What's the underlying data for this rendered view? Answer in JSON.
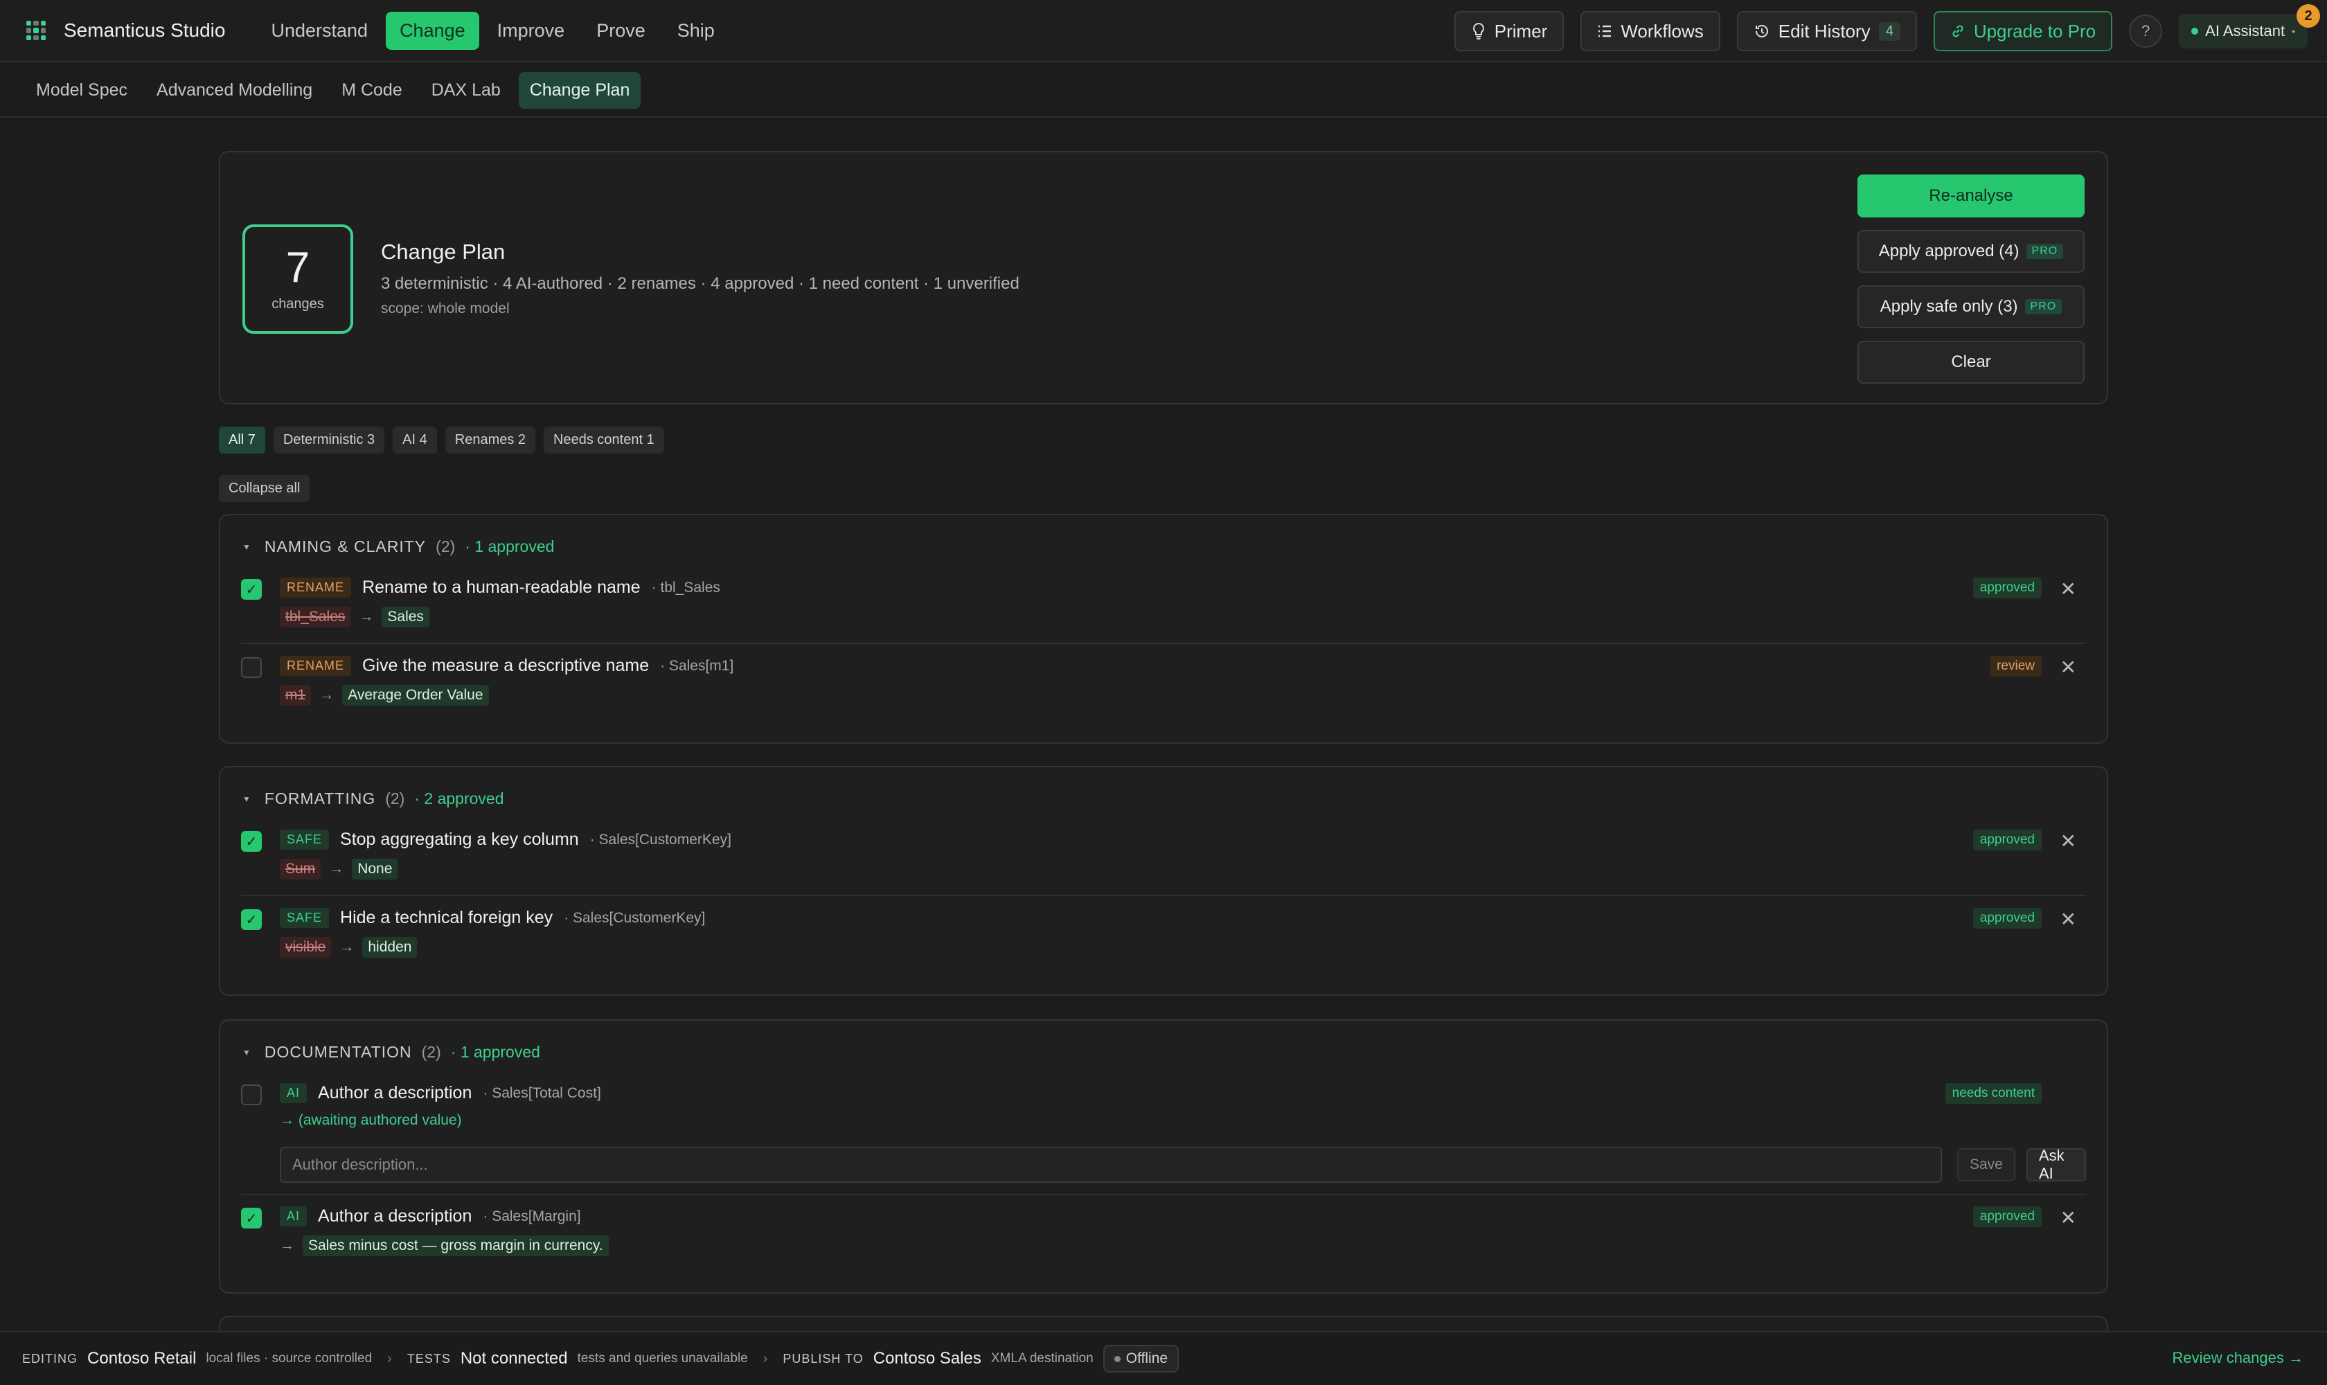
{
  "app": {
    "brand": "Semanticus Studio"
  },
  "nav": {
    "items": [
      "Understand",
      "Change",
      "Improve",
      "Prove",
      "Ship"
    ],
    "active": "Change"
  },
  "top": {
    "primer": "Primer",
    "workflows": "Workflows",
    "edit_history": "Edit History",
    "edit_history_count": "4",
    "upgrade": "Upgrade to Pro",
    "help": "?",
    "ai_assistant": "AI Assistant",
    "ai_badge": "2"
  },
  "subnav": {
    "items": [
      "Model Spec",
      "Advanced Modelling",
      "M Code",
      "DAX Lab",
      "Change Plan"
    ],
    "active": "Change Plan"
  },
  "summary": {
    "count": "7",
    "count_label": "changes",
    "title": "Change Plan",
    "meta": "3 deterministic · 4 AI-authored · 2 renames · 4 approved · 1 need content · 1 unverified",
    "scope": "scope: whole model",
    "reanalyse": "Re-analyse",
    "apply_approved": "Apply approved (4)",
    "apply_safe": "Apply safe only (3)",
    "pro": "PRO",
    "clear": "Clear"
  },
  "filters": [
    "All 7",
    "Deterministic 3",
    "AI 4",
    "Renames 2",
    "Needs content 1"
  ],
  "collapse_all": "Collapse all",
  "groups": [
    {
      "title": "NAMING & CLARITY",
      "count": "(2)",
      "approved": "· 1 approved",
      "rows": [
        {
          "checked": true,
          "tag": "RENAME",
          "title": "Rename to a human-readable name",
          "target": "· tbl_Sales",
          "old": "tbl_Sales",
          "new": "Sales",
          "status": "approved"
        },
        {
          "checked": false,
          "tag": "RENAME",
          "title": "Give the measure a descriptive name",
          "target": "· Sales[m1]",
          "old": "m1",
          "new": "Average Order Value",
          "status": "review"
        }
      ]
    },
    {
      "title": "FORMATTING",
      "count": "(2)",
      "approved": "· 2 approved",
      "rows": [
        {
          "checked": true,
          "tag": "SAFE",
          "title": "Stop aggregating a key column",
          "target": "· Sales[CustomerKey]",
          "old": "Sum",
          "new": "None",
          "status": "approved"
        },
        {
          "checked": true,
          "tag": "SAFE",
          "title": "Hide a technical foreign key",
          "target": "· Sales[CustomerKey]",
          "old": "visible",
          "new": "hidden",
          "status": "approved"
        }
      ]
    },
    {
      "title": "DOCUMENTATION",
      "count": "(2)",
      "approved": "· 1 approved",
      "rows": [
        {
          "checked": false,
          "tag": "AI",
          "title": "Author a description",
          "target": "· Sales[Total Cost]",
          "awaiting": "→ (awaiting authored value)",
          "status": "needs content",
          "input_placeholder": "Author description...",
          "save": "Save",
          "ask_ai": "Ask AI"
        },
        {
          "checked": true,
          "tag": "AI",
          "title": "Author a description",
          "target": "· Sales[Margin]",
          "new": "Sales minus cost — gross margin in currency.",
          "status": "approved"
        }
      ]
    }
  ],
  "arrow": "→",
  "statusbar": {
    "editing_key": "EDITING",
    "editing_val": "Contoso Retail",
    "editing_note": "local files · source controlled",
    "tests_key": "TESTS",
    "tests_val": "Not connected",
    "tests_note": "tests and queries unavailable",
    "publish_key": "PUBLISH TO",
    "publish_val": "Contoso Sales",
    "publish_note": "XMLA destination",
    "offline": "Offline",
    "review": "Review changes →"
  },
  "colors": {
    "accent": "#27c770",
    "accent_text": "#3ecf8e",
    "background": "#1c1c1c",
    "warn": "#e9a25a"
  }
}
